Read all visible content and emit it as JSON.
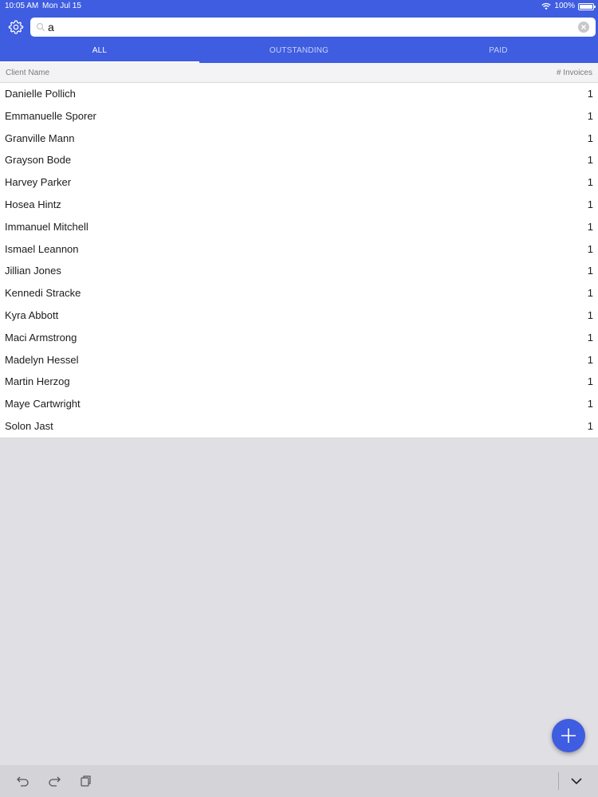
{
  "status_bar": {
    "time": "10:05 AM",
    "date": "Mon Jul 15",
    "battery": "100%"
  },
  "search": {
    "value": "a",
    "placeholder": ""
  },
  "tabs": [
    {
      "label": "ALL",
      "active": true
    },
    {
      "label": "OUTSTANDING",
      "active": false
    },
    {
      "label": "PAID",
      "active": false
    }
  ],
  "table": {
    "columns": [
      "Client Name",
      "# Invoices"
    ],
    "rows": [
      {
        "name": "Danielle Pollich",
        "count": "1"
      },
      {
        "name": "Emmanuelle Sporer",
        "count": "1"
      },
      {
        "name": "Granville Mann",
        "count": "1"
      },
      {
        "name": "Grayson Bode",
        "count": "1"
      },
      {
        "name": "Harvey Parker",
        "count": "1"
      },
      {
        "name": "Hosea Hintz",
        "count": "1"
      },
      {
        "name": "Immanuel Mitchell",
        "count": "1"
      },
      {
        "name": "Ismael Leannon",
        "count": "1"
      },
      {
        "name": "Jillian Jones",
        "count": "1"
      },
      {
        "name": "Kennedi Stracke",
        "count": "1"
      },
      {
        "name": "Kyra Abbott",
        "count": "1"
      },
      {
        "name": "Maci Armstrong",
        "count": "1"
      },
      {
        "name": "Madelyn Hessel",
        "count": "1"
      },
      {
        "name": "Martin Herzog",
        "count": "1"
      },
      {
        "name": "Maye Cartwright",
        "count": "1"
      },
      {
        "name": "Solon Jast",
        "count": "1"
      }
    ]
  },
  "icons": {
    "settings": "gear-icon",
    "search": "search-icon",
    "clear": "clear-icon",
    "add": "plus-icon",
    "undo": "undo-icon",
    "redo": "redo-icon",
    "paste": "paste-icon",
    "hide_keyboard": "chevron-down-icon"
  },
  "colors": {
    "accent": "#3f5de0",
    "background": "#e0dfe4"
  }
}
